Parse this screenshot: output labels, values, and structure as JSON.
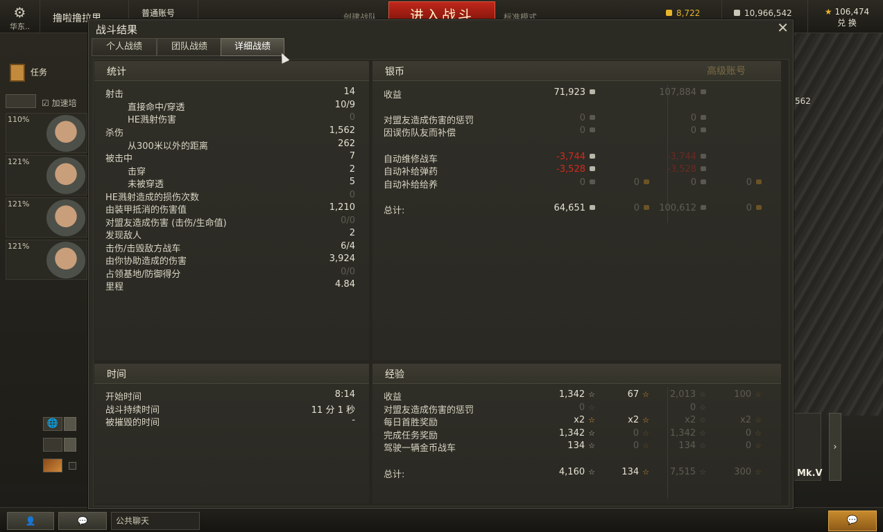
{
  "topbar": {
    "settings_label": "华东..",
    "nickname": "撸啦撸拉里",
    "account_type": "普通账号",
    "create_squad": "创建战队",
    "battle_button": "进入战斗",
    "mode": "标准模式",
    "gold": "8,722",
    "silver": "10,966,542",
    "free_xp": "106,474",
    "exchange": "兑 换"
  },
  "left": {
    "tasks_label": "任务",
    "accel_label": "加速培",
    "crew_pcts": [
      "110%",
      "121%",
      "121%",
      "121%"
    ],
    "partial_value": "562"
  },
  "bottom": {
    "chat_label": "公共聊天",
    "tank_name": "Mk.V"
  },
  "dialog": {
    "title": "战斗结果",
    "tabs": [
      "个人战绩",
      "团队战绩",
      "详细战绩"
    ],
    "premium_label": "高级账号",
    "stats": {
      "header": "统计",
      "rows": [
        {
          "label": "射击",
          "value": "14"
        },
        {
          "label": "直接命中/穿透",
          "value": "10/9"
        },
        {
          "label": "HE溅射伤害",
          "value": "0"
        },
        {
          "label": "杀伤",
          "value": "1,562"
        },
        {
          "label": "从300米以外的距离",
          "value": "262"
        },
        {
          "label": "被击中",
          "value": "7"
        },
        {
          "label": "击穿",
          "value": "2"
        },
        {
          "label": "未被穿透",
          "value": "5"
        },
        {
          "label": "HE溅射造成的损伤次数",
          "value": "0"
        },
        {
          "label": "由装甲抵消的伤害值",
          "value": "1,210"
        },
        {
          "label": "对盟友造成伤害 (击伤/生命值)",
          "value": "0/0"
        },
        {
          "label": "发现敌人",
          "value": "2"
        },
        {
          "label": "击伤/击毁敌方战车",
          "value": "6/4"
        },
        {
          "label": "由你协助造成的伤害",
          "value": "3,924"
        },
        {
          "label": "占领基地/防御得分",
          "value": "0/0"
        },
        {
          "label": "里程",
          "value": "4.84"
        }
      ]
    },
    "silver": {
      "header": "银币",
      "rows": [
        {
          "label": "收益",
          "a": "71,923",
          "b": "",
          "pa": "107,884",
          "pb": ""
        },
        {
          "label": "对盟友造成伤害的惩罚",
          "a": "0",
          "b": "",
          "pa": "0",
          "pb": ""
        },
        {
          "label": "因误伤队友而补偿",
          "a": "0",
          "b": "",
          "pa": "0",
          "pb": ""
        },
        {
          "label": "自动维修战车",
          "a": "-3,744",
          "b": "",
          "pa": "-3,744",
          "pb": ""
        },
        {
          "label": "自动补给弹药",
          "a": "-3,528",
          "b": "",
          "pa": "-3,528",
          "pb": ""
        },
        {
          "label": "自动补给给养",
          "a": "0",
          "b": "0",
          "pa": "0",
          "pb": "0"
        },
        {
          "label": "总计:",
          "a": "64,651",
          "b": "0",
          "pa": "100,612",
          "pb": "0"
        }
      ]
    },
    "time": {
      "header": "时间",
      "rows": [
        {
          "label": "开始时间",
          "value": "8:14"
        },
        {
          "label": "战斗持续时间",
          "value": "11 分 1 秒"
        },
        {
          "label": "被摧毁的时间",
          "value": "-"
        }
      ]
    },
    "xp": {
      "header": "经验",
      "rows": [
        {
          "label": "收益",
          "a": "1,342",
          "b": "67",
          "pa": "2,013",
          "pb": "100"
        },
        {
          "label": "对盟友造成伤害的惩罚",
          "a": "0",
          "b": "",
          "pa": "0",
          "pb": ""
        },
        {
          "label": "每日首胜奖励",
          "a": "x2",
          "b": "x2",
          "pa": "x2",
          "pb": "x2"
        },
        {
          "label": "完成任务奖励",
          "a": "1,342",
          "b": "0",
          "pa": "1,342",
          "pb": "0"
        },
        {
          "label": "驾驶一辆金币战车",
          "a": "134",
          "b": "0",
          "pa": "134",
          "pb": "0"
        },
        {
          "label": "总计:",
          "a": "4,160",
          "b": "134",
          "pa": "7,515",
          "pb": "300"
        }
      ]
    }
  }
}
